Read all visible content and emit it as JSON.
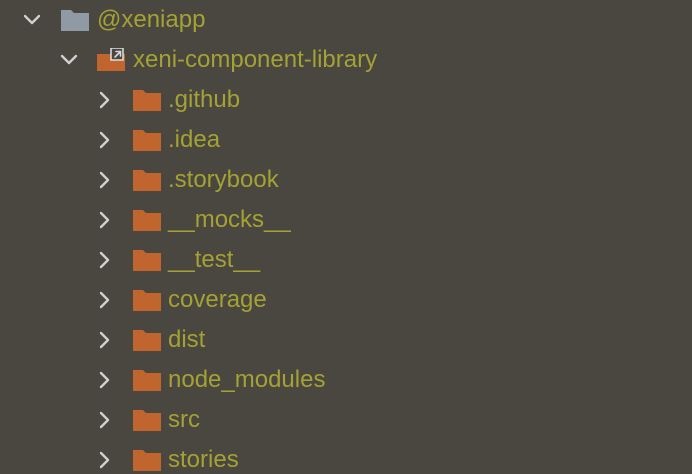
{
  "colors": {
    "background": "#4a4640",
    "label_text": "#a3a233",
    "chevron": "#d0d0d0",
    "root_folder": "#8f9aa5",
    "project_folder": "#c0652d",
    "child_folder": "#c0652d",
    "link_overlay": "#d8d8d8"
  },
  "icons": {
    "expanded": "chevron-down-icon",
    "collapsed": "chevron-right-icon",
    "root": "folder-icon",
    "project": "module-folder-link-icon",
    "child": "folder-icon"
  },
  "tree": {
    "root": {
      "label": "@xeniapp",
      "expanded": true
    },
    "project": {
      "label": "xeni-component-library",
      "expanded": true
    },
    "children": [
      {
        "label": ".github"
      },
      {
        "label": ".idea"
      },
      {
        "label": ".storybook"
      },
      {
        "label": "__mocks__"
      },
      {
        "label": "__test__"
      },
      {
        "label": "coverage"
      },
      {
        "label": "dist"
      },
      {
        "label": "node_modules"
      },
      {
        "label": "src"
      },
      {
        "label": "stories"
      }
    ]
  }
}
